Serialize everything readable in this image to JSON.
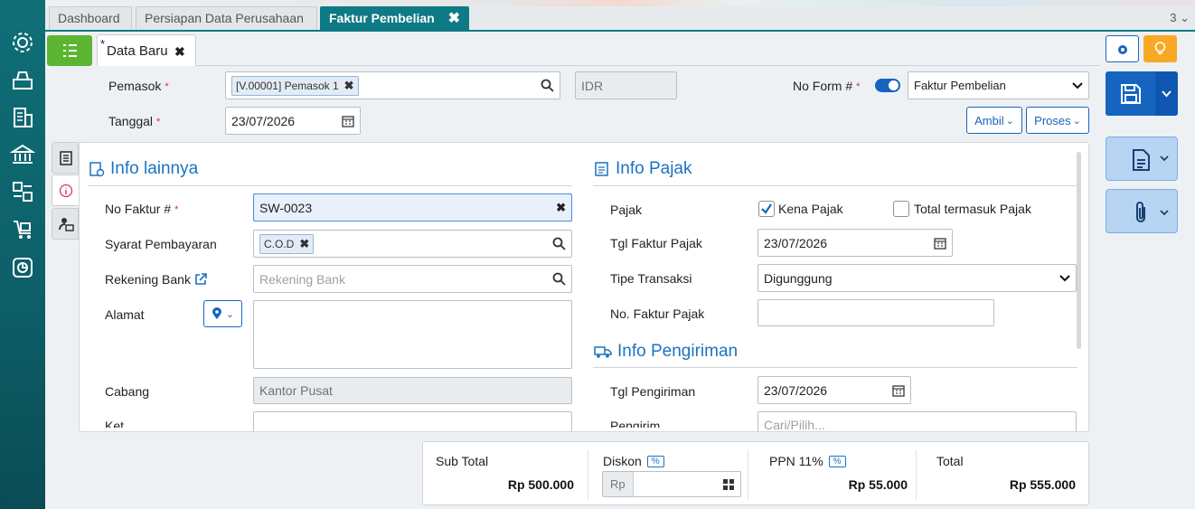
{
  "tabs": [
    "Dashboard",
    "Persiapan Data Perusahaan",
    "Faktur Pembelian"
  ],
  "tab_count": "3",
  "sub_tab": {
    "modified_mark": "*",
    "label": "Data Baru"
  },
  "header_form": {
    "supplier_label": "Pemasok",
    "supplier_chip": "[V.00001] Pemasok 1",
    "currency": "IDR",
    "date_label": "Tanggal",
    "date_value": "23/07/2026",
    "no_form_label": "No Form #",
    "form_type": "Faktur Pembelian",
    "ambil_label": "Ambil",
    "proses_label": "Proses",
    "required_mark": "*"
  },
  "info_lainnya": {
    "title": "Info lainnya",
    "no_faktur_label": "No Faktur #",
    "no_faktur_value": "SW-0023",
    "syarat_label": "Syarat Pembayaran",
    "syarat_chip": "C.O.D",
    "rekening_label": "Rekening Bank",
    "rekening_placeholder": "Rekening Bank",
    "alamat_label": "Alamat",
    "cabang_label": "Cabang",
    "cabang_value": "Kantor Pusat",
    "next_label_partial": "Ket..."
  },
  "info_pajak": {
    "title": "Info Pajak",
    "pajak_label": "Pajak",
    "kena_pajak_label": "Kena Pajak",
    "kena_pajak_checked": true,
    "total_termasuk_label": "Total termasuk Pajak",
    "total_termasuk_checked": false,
    "tgl_faktur_label": "Tgl Faktur Pajak",
    "tgl_faktur_value": "23/07/2026",
    "tipe_label": "Tipe Transaksi",
    "tipe_value": "Digunggung",
    "no_faktur_pajak_label": "No. Faktur Pajak"
  },
  "info_pengiriman": {
    "title": "Info Pengiriman",
    "tgl_label": "Tgl Pengiriman",
    "tgl_value": "23/07/2026",
    "next_label_partial": "Pengirim...",
    "next_placeholder": "Cari/Pilih..."
  },
  "totals": {
    "subtotal_label": "Sub Total",
    "subtotal_value": "Rp 500.000",
    "diskon_label": "Diskon",
    "pct_symbol": "%",
    "diskon_prefix": "Rp",
    "ppn_label": "PPN 11%",
    "ppn_value": "Rp 55.000",
    "total_label": "Total",
    "total_value": "Rp 555.000"
  },
  "colors": {
    "teal": "#0e7a85",
    "green": "#5cb531",
    "blue": "#1565c0",
    "orange": "#f9a825",
    "link": "#1a73c2"
  }
}
